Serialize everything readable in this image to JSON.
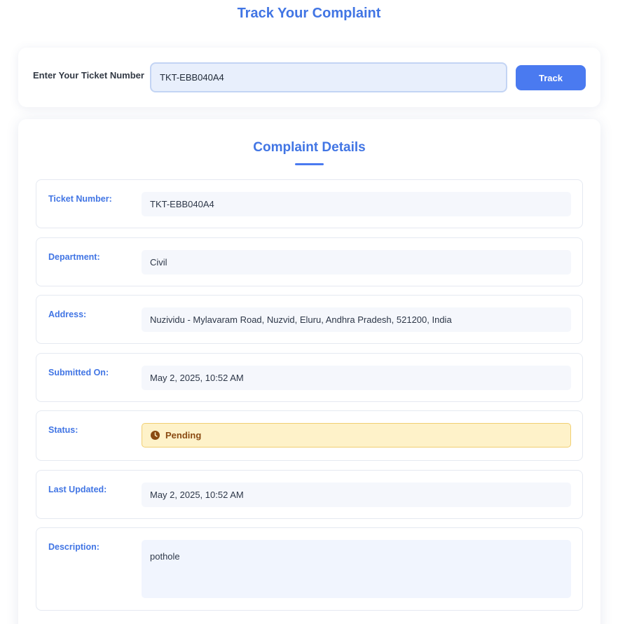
{
  "page": {
    "title": "Track Your Complaint"
  },
  "search": {
    "label": "Enter Your Ticket Number",
    "value": "TKT-EBB040A4",
    "button_label": "Track"
  },
  "details": {
    "title": "Complaint Details",
    "ticket": {
      "label": "Ticket Number:",
      "value": "TKT-EBB040A4"
    },
    "department": {
      "label": "Department:",
      "value": "Civil"
    },
    "address": {
      "label": "Address:",
      "value": "Nuzividu - Mylavaram Road, Nuzvid, Eluru, Andhra Pradesh, 521200, India"
    },
    "submitted": {
      "label": "Submitted On:",
      "value": "May 2, 2025, 10:52 AM"
    },
    "status": {
      "label": "Status:",
      "value": "Pending",
      "icon": "clock-icon",
      "color": "#8a4b12",
      "background": "#fef2c9"
    },
    "updated": {
      "label": "Last Updated:",
      "value": "May 2, 2025, 10:52 AM"
    },
    "description": {
      "label": "Description:",
      "value": "pothole"
    }
  },
  "colors": {
    "accent": "#4175e4",
    "button": "#4a7af0"
  }
}
